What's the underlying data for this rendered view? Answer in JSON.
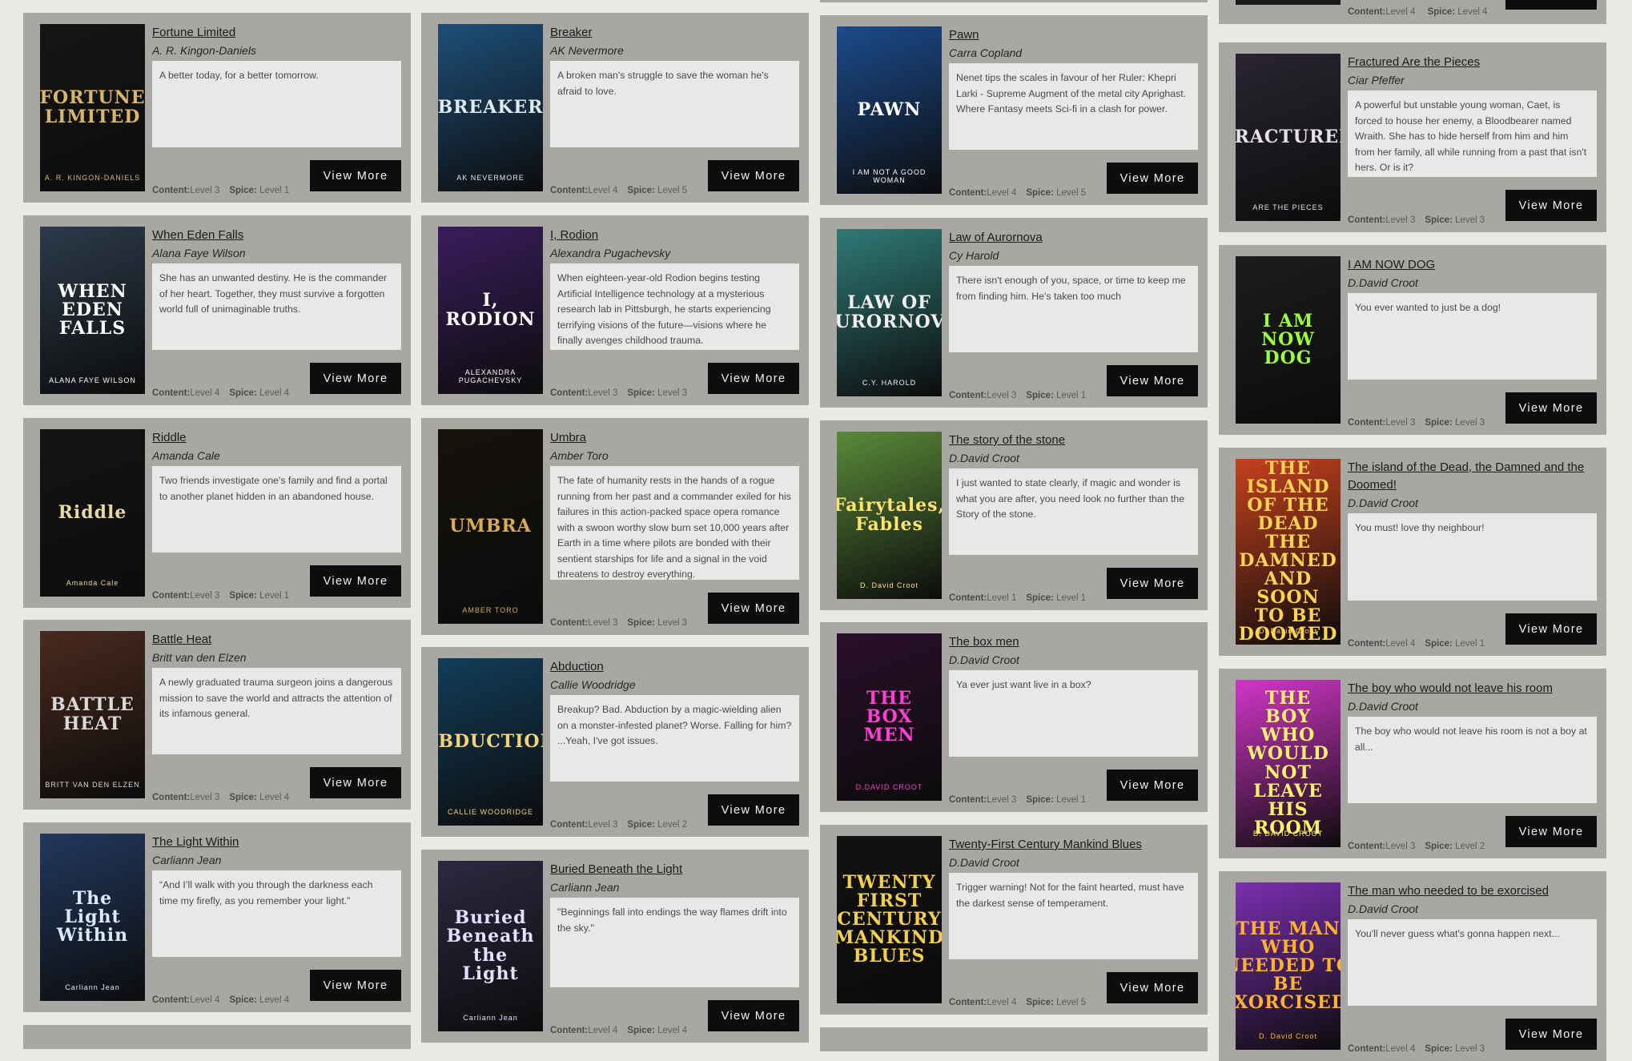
{
  "labels": {
    "content": "Content:",
    "spice": "Spice:",
    "view_more": "View More"
  },
  "cards": [
    {
      "title": "Fortune Limited",
      "author": "A. R. Kingon-Daniels",
      "desc": "A better today, for a better tomorrow.",
      "content": "Level 3",
      "spice": "Level 1",
      "cover_text": "FORTUNE LIMITED",
      "cover_author": "A. R. KINGON-DANIELS",
      "cover_bg": "#161616",
      "cover_fg": "#d8b66a"
    },
    {
      "title": "When Eden Falls",
      "author": "Alana Faye Wilson",
      "desc": "She has an unwanted destiny. He is the commander of her heart. Together, they must survive a forgotten world full of unimaginable truths.",
      "content": "Level 4",
      "spice": "Level 4",
      "cover_text": "WHEN EDEN FALLS",
      "cover_author": "ALANA FAYE WILSON",
      "cover_bg": "#2c3a4a",
      "cover_fg": "#ffffff"
    },
    {
      "title": "Riddle",
      "author": "Amanda Cale",
      "desc": "Two friends investigate one's family and find a portal to another planet hidden in an abandoned house.",
      "content": "Level 3",
      "spice": "Level 1",
      "cover_text": "Riddle",
      "cover_author": "Amanda Cale",
      "cover_bg": "#141414",
      "cover_fg": "#e8d9a0"
    },
    {
      "title": "Battle Heat",
      "author": "Britt van den Elzen",
      "desc": "A newly graduated trauma surgeon joins a dangerous mission to save the world and attracts the attention of its infamous general.",
      "content": "Level 3",
      "spice": "Level 4",
      "cover_text": "BATTLE HEAT",
      "cover_author": "BRITT VAN DEN ELZEN",
      "cover_bg": "#4a2a1e",
      "cover_fg": "#d9d9d9"
    },
    {
      "title": "The Light Within",
      "author": "Carliann Jean",
      "desc": "“And I’ll walk with you through the darkness each time my firefly, as you remember your light.”",
      "content": "Level 4",
      "spice": "Level 4",
      "cover_text": "The Light Within",
      "cover_author": "Carliann Jean",
      "cover_bg": "#22385e",
      "cover_fg": "#dbe9ff"
    },
    {
      "title": "Breaker",
      "author": "AK Nevermore",
      "desc": "A broken man's struggle to save the woman he's afraid to love.",
      "content": "Level 4",
      "spice": "Level 5",
      "cover_text": "BREAKER",
      "cover_author": "AK NEVERMORE",
      "cover_bg": "#1e4f79",
      "cover_fg": "#dfeaf2"
    },
    {
      "title": "I, Rodion",
      "author": "Alexandra Pugachevsky",
      "desc": "When eighteen-year-old Rodion begins testing Artificial Intelligence technology at a mysterious research lab in Pittsburgh, he starts experiencing terrifying visions of the future—visions where he finally avenges childhood trauma.",
      "content": "Level 3",
      "spice": "Level 3",
      "cover_text": "I, RODION",
      "cover_author": "ALEXANDRA PUGACHEVSKY",
      "cover_bg": "#3a1d5c",
      "cover_fg": "#ffffff"
    },
    {
      "title": "Umbra",
      "author": "Amber Toro",
      "desc": "The fate of humanity rests in the hands of a rogue running from her past and a commander exiled for his failures in this action-packed space opera romance with a swoon worthy slow burn set 10,000 years after Earth in a time where pilots are bonded with their sentient starships for life and a signal in the void threatens to destroy everything.",
      "content": "Level 3",
      "spice": "Level 3",
      "cover_text": "UMBRA",
      "cover_author": "AMBER TORO",
      "cover_bg": "#16120c",
      "cover_fg": "#d8ac52"
    },
    {
      "title": "Abduction",
      "author": "Callie Woodridge",
      "desc": "Breakup? Bad. Abduction by a magic-wielding alien on a monster-infested planet? Worse. Falling for him? ...Yeah, I've got issues.",
      "content": "Level 3",
      "spice": "Level 2",
      "cover_text": "ABDUCTION",
      "cover_author": "CALLIE WOODRIDGE",
      "cover_bg": "#123d5a",
      "cover_fg": "#f3d27a"
    },
    {
      "title": "Buried Beneath the Light",
      "author": "Carliann Jean",
      "desc": "\"Beginnings fall into endings the way flames drift into the sky.\"",
      "content": "Level 4",
      "spice": "Level 4",
      "cover_text": "Buried Beneath the Light",
      "cover_author": "Carliann Jean",
      "cover_bg": "#2d2840",
      "cover_fg": "#e4e0ff"
    },
    {
      "title": "Pawn",
      "author": "Carra Copland",
      "desc": "Nenet tips the scales in favour of her Ruler: Khepri Larki - Supreme Augment of the metal city Aprighast. Where Fantasy meets Sci-fi in a clash for power.",
      "content": "Level 4",
      "spice": "Level 5",
      "cover_text": "PAWN",
      "cover_author": "I AM NOT A GOOD WOMAN",
      "cover_bg": "#1c4b8c",
      "cover_fg": "#ffffff"
    },
    {
      "title": "Law of Aurornova",
      "author": "Cy Harold",
      "desc": "There isn't enough of you, space, or time to keep me from finding him. He's taken too much",
      "content": "Level 3",
      "spice": "Level 1",
      "cover_text": "LAW OF AURORNOVA",
      "cover_author": "C.Y. HAROLD",
      "cover_bg": "#2f7a76",
      "cover_fg": "#f0f0f0"
    },
    {
      "title": "The story of the stone",
      "author": "D.David Croot",
      "desc": "I just wanted to state clearly, if magic and wonder is what you are after, you need look no further than the Story of the stone.",
      "content": "Level 1",
      "spice": "Level 1",
      "cover_text": "Fairytales, Fables",
      "cover_author": "D. David Croot",
      "cover_bg": "#5a8a3a",
      "cover_fg": "#ffe36b"
    },
    {
      "title": "The box men",
      "author": "D.David Croot",
      "desc": "Ya ever just want live in a box?",
      "content": "Level 3",
      "spice": "Level 1",
      "cover_text": "THE BOX MEN",
      "cover_author": "D.DAVID CROOT",
      "cover_bg": "#2a0f2a",
      "cover_fg": "#ff3fd2"
    },
    {
      "title": "Twenty-First Century Mankind Blues",
      "author": "D.David Croot",
      "desc": "Trigger warning! Not for the faint hearted, must have the darkest sense of temperament.",
      "content": "Level 4",
      "spice": "Level 5",
      "cover_text": "TWENTY FIRST CENTURY MANKIND BLUES",
      "cover_author": "",
      "cover_bg": "#111111",
      "cover_fg": "#f4d04a"
    },
    {
      "title": "Fractured Are the Pieces",
      "author": "Ciar Pfeffer",
      "desc": "A powerful but unstable young woman, Caet, is forced to house her enemy, a Bloodbearer named Wraith. She has to hide herself from him and him from her family, all while running from a past that isn't hers. Or is it?",
      "content": "Level 3",
      "spice": "Level 3",
      "cover_text": "FRACTURED",
      "cover_author": "ARE THE PIECES",
      "cover_bg": "#2a2530",
      "cover_fg": "#e6e0ea"
    },
    {
      "title": "I AM NOW DOG",
      "author": "D.David Croot",
      "desc": "You ever wanted to just be a dog!",
      "content": "Level 3",
      "spice": "Level 3",
      "cover_text": "I AM NOW DOG",
      "cover_author": "",
      "cover_bg": "#1c1c1c",
      "cover_fg": "#9cff3c"
    },
    {
      "title": "The island of the Dead, the Damned and the Doomed!",
      "author": "D.David Croot",
      "desc": "You must! love thy neighbour!",
      "content": "Level 4",
      "spice": "Level 1",
      "cover_text": "THE ISLAND OF THE DEAD THE DAMNED AND SOON TO BE DOOMED",
      "cover_author": "D. David Croot",
      "cover_bg": "#c4411e",
      "cover_fg": "#ffd54f"
    },
    {
      "title": "The boy who would not leave his room",
      "author": "D.David Croot",
      "desc": "The boy who would not leave his room is not a boy at all...",
      "content": "Level 3",
      "spice": "Level 2",
      "cover_text": "THE BOY WHO WOULD NOT LEAVE HIS ROOM",
      "cover_author": "D. DAVID CROOT",
      "cover_bg": "#d236c9",
      "cover_fg": "#fff36b"
    },
    {
      "title": "The man who needed to be exorcised",
      "author": "D.David Croot",
      "desc": "You'll never guess what's gonna happen next...",
      "content": "Level 4",
      "spice": "Level 3",
      "cover_text": "THE MAN WHO NEEDED TO BE EXORCISED!",
      "cover_author": "D. David Croot",
      "cover_bg": "#7a2fb0",
      "cover_fg": "#ffb32b"
    }
  ],
  "partial_top": {
    "content": "Level 4",
    "spice": "Level 4"
  }
}
